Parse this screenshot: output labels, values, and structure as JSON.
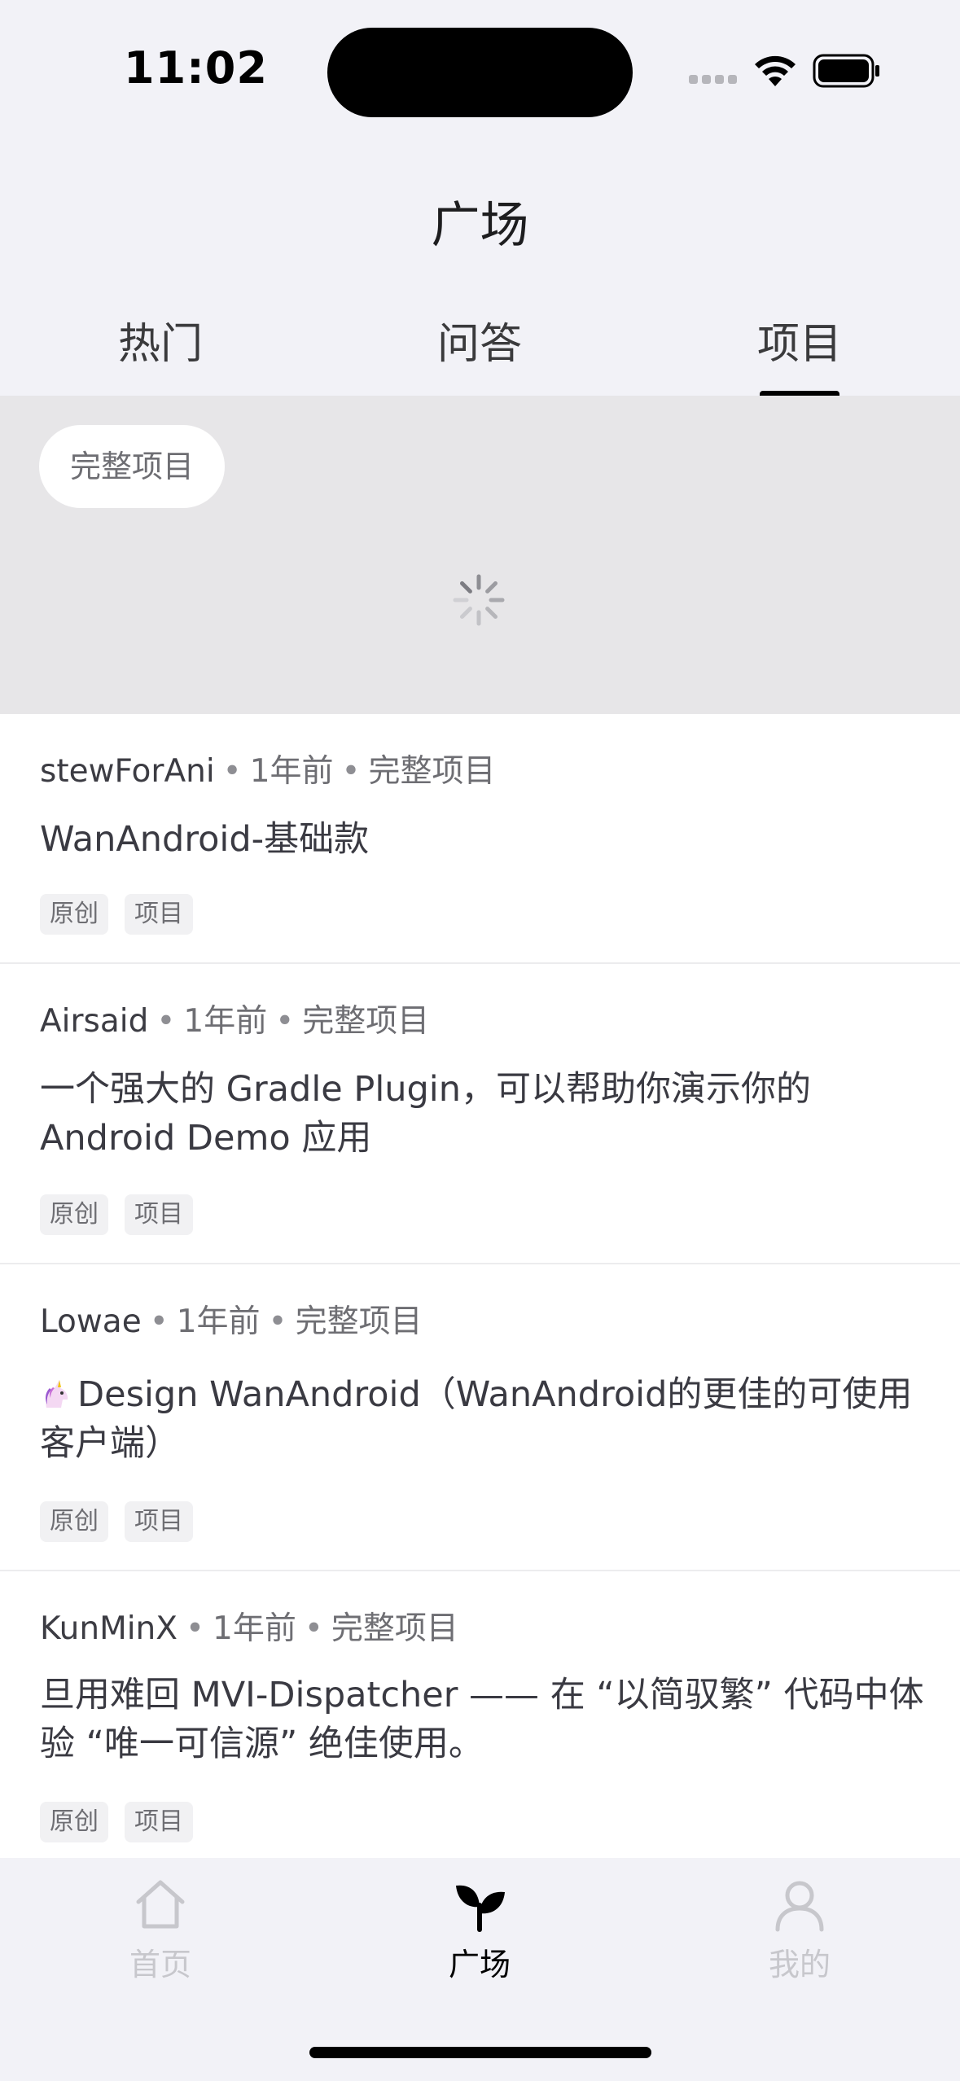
{
  "status_bar": {
    "time": "11:02"
  },
  "header": {
    "title": "广场",
    "tabs": [
      {
        "label": "热门"
      },
      {
        "label": "问答"
      },
      {
        "label": "项目"
      }
    ],
    "active_tab": "项目"
  },
  "filter": {
    "chip_label": "完整项目"
  },
  "articles": [
    {
      "author": "stewForAni",
      "time": "1年前",
      "category": "完整项目",
      "title": "WanAndroid-基础款",
      "tags": [
        "原创",
        "项目"
      ]
    },
    {
      "author": "Airsaid",
      "time": "1年前",
      "category": "完整项目",
      "title": "一个强大的 Gradle Plugin，可以帮助你演示你的 Android Demo 应用",
      "tags": [
        "原创",
        "项目"
      ]
    },
    {
      "author": "Lowae",
      "time": "1年前",
      "category": "完整项目",
      "title": "Design WanAndroid（WanAndroid的更佳的可使用客户端）",
      "emoji_icon": "unicorn-icon",
      "tags": [
        "原创",
        "项目"
      ]
    },
    {
      "author": "KunMinX",
      "time": "1年前",
      "category": "完整项目",
      "title": "旦用难回 MVI-Dispatcher —— 在 “以简驭繁” 代码中体验 “唯一可信源” 绝佳使用。",
      "tags": [
        "原创",
        "项目"
      ]
    }
  ],
  "tabbar": {
    "items": [
      {
        "label": "首页",
        "icon": "home-icon"
      },
      {
        "label": "广场",
        "icon": "sprout-icon"
      },
      {
        "label": "我的",
        "icon": "person-icon"
      }
    ],
    "active": "广场"
  },
  "colors": {
    "accent": "#000000",
    "background": "#f2f2f7",
    "filter_bg": "#e7e6e8",
    "inactive": "#c7c7cc"
  }
}
